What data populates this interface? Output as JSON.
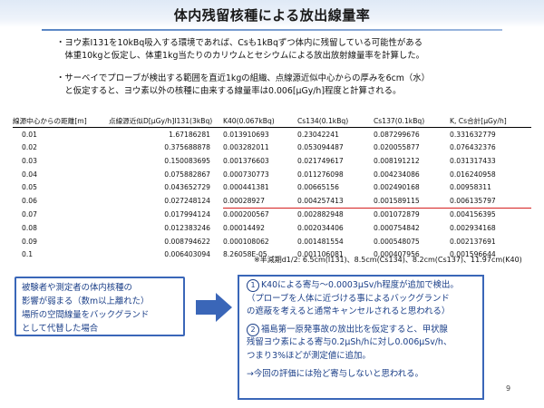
{
  "title": "体内残留核種による放出線量率",
  "bullets": [
    {
      "line1": "・ヨウ素I131を10kBq吸入する環境であれば、Csも1kBqずつ体内に残留している可能性がある",
      "line2": "　体重10kgと仮定し、体重1kg当たりのカリウムとセシウムによる放出放射線量率を計算した。"
    },
    {
      "line1": "・サーベイでプローブが検出する範囲を直近1kgの組織、点線源近似中心からの厚みを6cm（水）",
      "line2": "　と仮定すると、ヨウ素以外の核種に由来する線量率は0.006[μGy/h]程度と計算される。"
    }
  ],
  "table": {
    "headers": [
      "線源中心からの距離[m]",
      "点線源近似D[μGy/h]I131(3kBq)",
      "K40(0.067kBq)",
      "Cs134(0.1kBq)",
      "Cs137(0.1kBq)",
      "K, Cs合計[μGy/h]"
    ],
    "rows": [
      [
        "0.01",
        "1.67186281",
        "0.013910693",
        "0.23042241",
        "0.087299676",
        "0.331632779"
      ],
      [
        "0.02",
        "0.375688878",
        "0.003282011",
        "0.053094487",
        "0.020055877",
        "0.076432376"
      ],
      [
        "0.03",
        "0.150083695",
        "0.001376603",
        "0.021749617",
        "0.008191212",
        "0.031317433"
      ],
      [
        "0.04",
        "0.075882867",
        "0.000730773",
        "0.011276098",
        "0.004234086",
        "0.016240958"
      ],
      [
        "0.05",
        "0.043652729",
        "0.000441381",
        "0.00665156",
        "0.002490168",
        "0.00958311"
      ],
      [
        "0.06",
        "0.027248124",
        "0.00028927",
        "0.004257413",
        "0.001589115",
        "0.006135797"
      ],
      [
        "0.07",
        "0.017994124",
        "0.000200567",
        "0.002882948",
        "0.001072879",
        "0.004156395"
      ],
      [
        "0.08",
        "0.012383246",
        "0.00014492",
        "0.002034406",
        "0.000754842",
        "0.002934168"
      ],
      [
        "0.09",
        "0.008794622",
        "0.000108062",
        "0.001481554",
        "0.000548075",
        "0.002137691"
      ],
      [
        "0.1",
        "0.006403094",
        "8.26058E-05",
        "0.001106081",
        "0.000407956",
        "0.001596644"
      ]
    ]
  },
  "half_life_note": "※半減期d1/2: 6.5cm(I131)、8.5cm(Cs134)、8.2cm(Cs137)、11.97cm(K40)",
  "left_box": {
    "line1": "被験者や測定者の体内核種の",
    "line2": "影響が弱まる（数m以上離れた）",
    "line3": "場所の空間線量をバックグランド",
    "line4": "として代替した場合"
  },
  "right_box": {
    "item1_num": "1",
    "item1_line1": "K40による寄与～0.0003μSv/h程度が追加で検出。",
    "item1_line2": "（プローブを人体に近づける事によるバックグランド",
    "item1_line3": "の遮蔽を考えると通常キャンセルされると思われる）",
    "item2_num": "2",
    "item2_line1": "福島第一原発事故の放出比を仮定すると、甲状腺",
    "item2_line2": "残留ヨウ素による寄与0.2μSh/hに対し0.006μSv/h、",
    "item2_line3": "つまり3%ほどが測定値に追加。",
    "conclusion": "→今回の評価には殆ど寄与しないと思われる。"
  },
  "page_number": "9",
  "colors": {
    "accent_blue": "#3a66b8",
    "text_blue": "#1b3f88",
    "highlight_red": "#d62020"
  },
  "highlighted_row_index": 5
}
